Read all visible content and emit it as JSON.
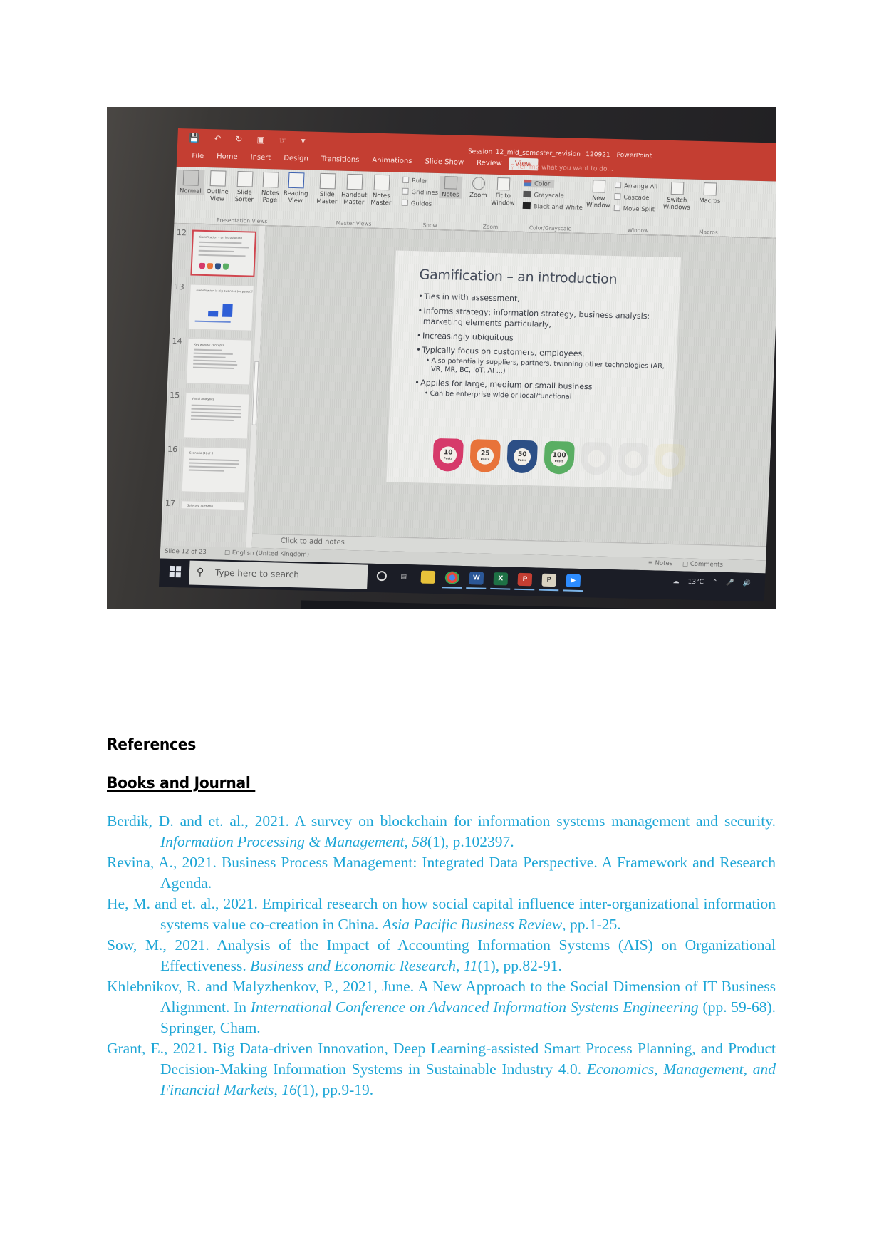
{
  "photo": {
    "window": {
      "document_title": "Session_12_mid_semester_revision_ 120921 - PowerPoint",
      "tabs": [
        "File",
        "Home",
        "Insert",
        "Design",
        "Transitions",
        "Animations",
        "Slide Show",
        "Review",
        "View"
      ],
      "active_tab": "View",
      "tell_me_placeholder": "Tell me what you want to do..."
    },
    "ribbon": {
      "presentation_views": {
        "label": "Presentation Views",
        "buttons": [
          "Normal",
          "Outline View",
          "Slide Sorter",
          "Notes Page",
          "Reading View"
        ]
      },
      "master_views": {
        "label": "Master Views",
        "buttons": [
          "Slide Master",
          "Handout Master",
          "Notes Master"
        ]
      },
      "show": {
        "label": "Show",
        "checkboxes": [
          "Ruler",
          "Gridlines",
          "Guides"
        ],
        "notes_button": "Notes"
      },
      "zoom": {
        "label": "Zoom",
        "buttons": [
          "Zoom",
          "Fit to Window"
        ]
      },
      "color_grayscale": {
        "label": "Color/Grayscale",
        "options": [
          "Color",
          "Grayscale",
          "Black and White"
        ],
        "swatch_colors": [
          "#c55a5a",
          "#555555",
          "#222222"
        ]
      },
      "window": {
        "label": "Window",
        "new_window": "New Window",
        "options": [
          "Arrange All",
          "Cascade",
          "Move Split"
        ],
        "switch_windows": "Switch Windows"
      },
      "macros": {
        "label": "Macros",
        "button": "Macros"
      }
    },
    "thumbnails": [
      {
        "number": "12",
        "title": "Gamification – an introduction",
        "selected": true
      },
      {
        "number": "13",
        "title": "Gamification is big business (or paper)?",
        "selected": false
      },
      {
        "number": "14",
        "title": "Key words / concepts",
        "selected": false
      },
      {
        "number": "15",
        "title": "Visual Analytics",
        "selected": false
      },
      {
        "number": "16",
        "title": "Scenario (1) of 3",
        "selected": false
      },
      {
        "number": "17",
        "title": "Selected Scenario",
        "selected": false
      }
    ],
    "slide": {
      "title": "Gamification – an introduction",
      "bullets": [
        {
          "text": "Ties in with assessment,",
          "level": 1
        },
        {
          "text": "Informs strategy; information strategy, business analysis; marketing elements particularly,",
          "level": 1
        },
        {
          "text": "Increasingly ubiquitous",
          "level": 1
        },
        {
          "text": "Typically focus on customers, employees,",
          "level": 1
        },
        {
          "text": "Also potentially suppliers, partners, twinning other technologies (AR, VR, MR, BC, IoT, AI ...)",
          "level": 2
        },
        {
          "text": "Applies for large, medium or small business",
          "level": 1
        },
        {
          "text": "Can be enterprise wide or local/functional",
          "level": 2
        }
      ],
      "badges": [
        {
          "value": "10",
          "unit": "Posts",
          "color": "#d63a6a"
        },
        {
          "value": "25",
          "unit": "Posts",
          "color": "#e8733a"
        },
        {
          "value": "50",
          "unit": "Posts",
          "color": "#2c4f86"
        },
        {
          "value": "100",
          "unit": "Posts",
          "color": "#5aae63"
        },
        {
          "value": "",
          "unit": "",
          "color": "#bbbbbb"
        },
        {
          "value": "",
          "unit": "",
          "color": "#bbbbbb"
        },
        {
          "value": "",
          "unit": "",
          "color": "#e5d78a"
        }
      ]
    },
    "notes_placeholder": "Click to add notes",
    "statusbar": {
      "slide_position": "Slide 12 of 23",
      "language": "English (United Kingdom)",
      "notes": "Notes",
      "comments": "Comments"
    },
    "taskbar": {
      "search_placeholder": "Type here to search",
      "weather": "13°C",
      "second_search_placeholder": "to search"
    }
  },
  "references": {
    "heading": "References",
    "subheading": "Books and Journal ",
    "text_color": "#1ea6d6",
    "items": [
      {
        "parts": [
          {
            "t": "Berdik, D. and et. al., 2021. A survey on blockchain for information systems management and security. "
          },
          {
            "t": "Information Processing & Management",
            "i": true
          },
          {
            "t": ", "
          },
          {
            "t": "58",
            "i": true
          },
          {
            "t": "(1), p.102397."
          }
        ]
      },
      {
        "parts": [
          {
            "t": "Revina, A., 2021. Business Process Management: Integrated Data Perspective. A Framework and Research Agenda."
          }
        ]
      },
      {
        "parts": [
          {
            "t": "He, M. and et. al., 2021. Empirical research on how social capital influence inter-organizational information systems value co-creation in China. "
          },
          {
            "t": "Asia Pacific Business Review",
            "i": true
          },
          {
            "t": ", pp.1-25."
          }
        ]
      },
      {
        "parts": [
          {
            "t": "Sow, M., 2021. Analysis of the Impact of Accounting Information Systems (AIS) on Organizational Effectiveness. "
          },
          {
            "t": "Business and Economic Research",
            "i": true
          },
          {
            "t": ", "
          },
          {
            "t": "11",
            "i": true
          },
          {
            "t": "(1), pp.82-91."
          }
        ]
      },
      {
        "parts": [
          {
            "t": "Khlebnikov, R. and Malyzhenkov, P., 2021, June. A New Approach to the Social Dimension of IT Business Alignment. In "
          },
          {
            "t": "International Conference on Advanced Information Systems Engineering",
            "i": true
          },
          {
            "t": " (pp. 59-68). Springer, Cham."
          }
        ]
      },
      {
        "parts": [
          {
            "t": "Grant, E., 2021. Big Data-driven Innovation, Deep Learning-assisted Smart Process Planning, and Product Decision-Making Information Systems in Sustainable Industry 4.0. "
          },
          {
            "t": "Economics, Management, and Financial Markets",
            "i": true
          },
          {
            "t": ", "
          },
          {
            "t": "16",
            "i": true
          },
          {
            "t": "(1), pp.9-19."
          }
        ]
      }
    ]
  }
}
